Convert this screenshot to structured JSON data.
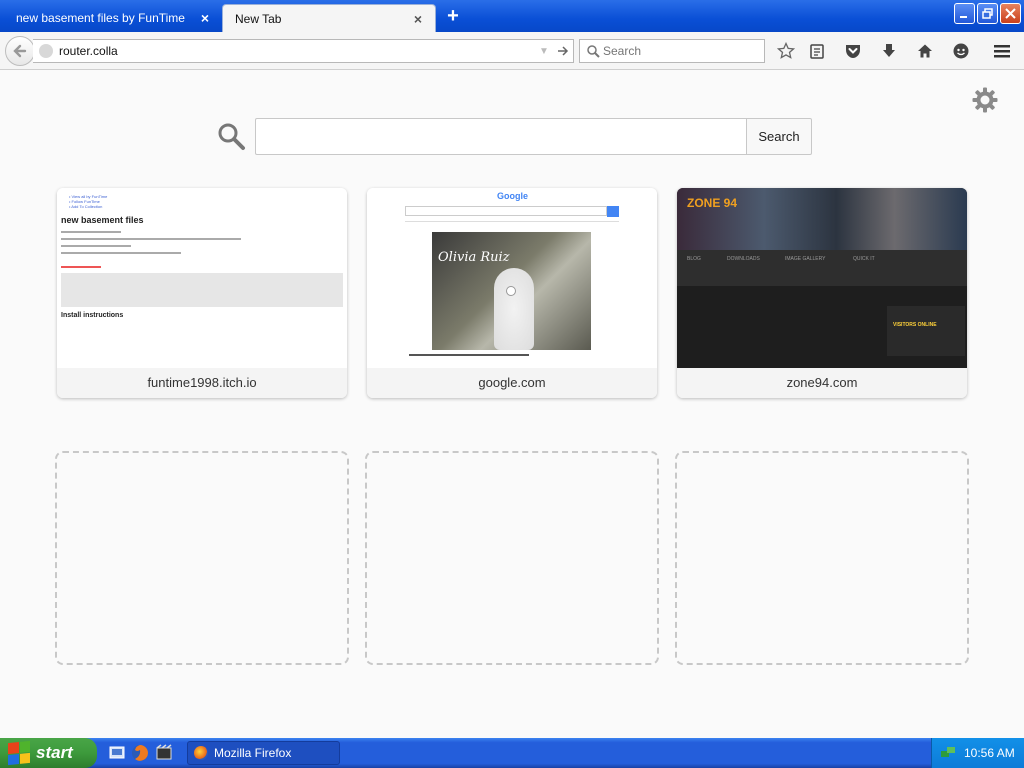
{
  "browser": {
    "tabs": [
      {
        "title": "new basement files by FunTime",
        "active": false
      },
      {
        "title": "New Tab",
        "active": true
      }
    ],
    "url_value": "router.colla",
    "search_placeholder": "Search"
  },
  "newtab": {
    "search_button_label": "Search",
    "search_value": "",
    "tiles": [
      {
        "label": "funtime1998.itch.io"
      },
      {
        "label": "google.com"
      },
      {
        "label": "zone94.com"
      }
    ],
    "placeholder_count": 3
  },
  "thumbs": {
    "itch": {
      "heading": "new basement files",
      "subheading": "Install instructions",
      "crumbs": [
        "• View all by FunTime",
        "• Follow FunTime",
        "• Add To Collection"
      ]
    },
    "google": {
      "logo": "Google",
      "video_text": "Olivia Ruiz"
    },
    "zone94": {
      "logo": "ZONE 94",
      "nav": [
        "BLOG",
        "DOWNLOADS",
        "IMAGE GALLERY",
        "QUICK IT"
      ],
      "panel_title": "VISITORS ONLINE"
    }
  },
  "taskbar": {
    "start_label": "start",
    "task_label": "Mozilla Firefox",
    "clock": "10:56 AM"
  },
  "colors": {
    "xp_blue": "#245edb",
    "start_green": "#3d9a3c",
    "tray_blue": "#0d7bd8"
  },
  "icons": [
    "back-arrow-icon",
    "go-arrow-icon",
    "magnifier-icon",
    "star-icon",
    "reading-list-icon",
    "pocket-icon",
    "download-icon",
    "home-icon",
    "chat-icon",
    "hamburger-menu-icon",
    "gear-icon"
  ]
}
